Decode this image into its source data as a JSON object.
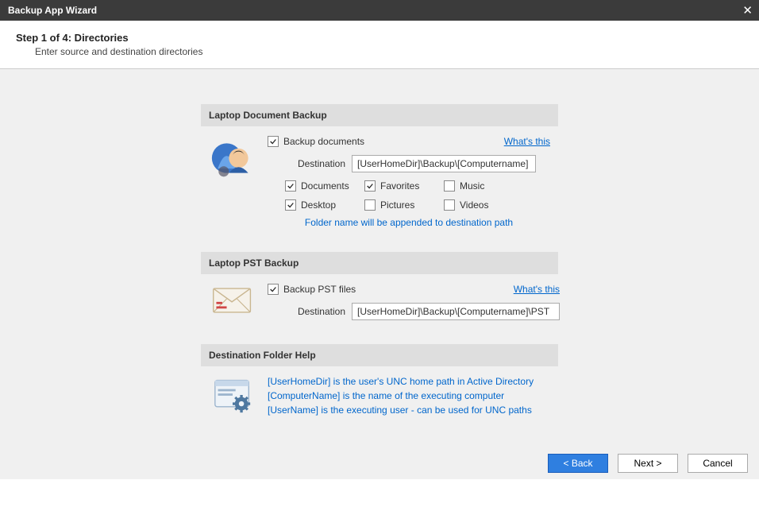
{
  "window": {
    "title": "Backup App Wizard"
  },
  "header": {
    "step_title": "Step 1 of 4: Directories",
    "step_sub": "Enter source and destination directories"
  },
  "doc_section": {
    "title": "Laptop Document Backup",
    "backup_label": "Backup documents",
    "whats_this": "What's this",
    "dest_label": "Destination",
    "dest_value": "[UserHomeDir]\\Backup\\[Computername]",
    "folders": [
      {
        "label": "Documents",
        "checked": true
      },
      {
        "label": "Favorites",
        "checked": true
      },
      {
        "label": "Music",
        "checked": false
      },
      {
        "label": "Desktop",
        "checked": true
      },
      {
        "label": "Pictures",
        "checked": false
      },
      {
        "label": "Videos",
        "checked": false
      }
    ],
    "note": "Folder name will be appended to destination path"
  },
  "pst_section": {
    "title": "Laptop PST Backup",
    "backup_label": "Backup PST files",
    "whats_this": "What's this",
    "dest_label": "Destination",
    "dest_value": "[UserHomeDir]\\Backup\\[Computername]\\PST"
  },
  "help_section": {
    "title": "Destination Folder Help",
    "lines": [
      "[UserHomeDir] is the user's UNC home path in Active Directory",
      "[ComputerName] is the name of the executing computer",
      "[UserName] is the executing user - can be used for UNC paths"
    ]
  },
  "footer": {
    "back": "< Back",
    "next": "Next >",
    "cancel": "Cancel"
  }
}
